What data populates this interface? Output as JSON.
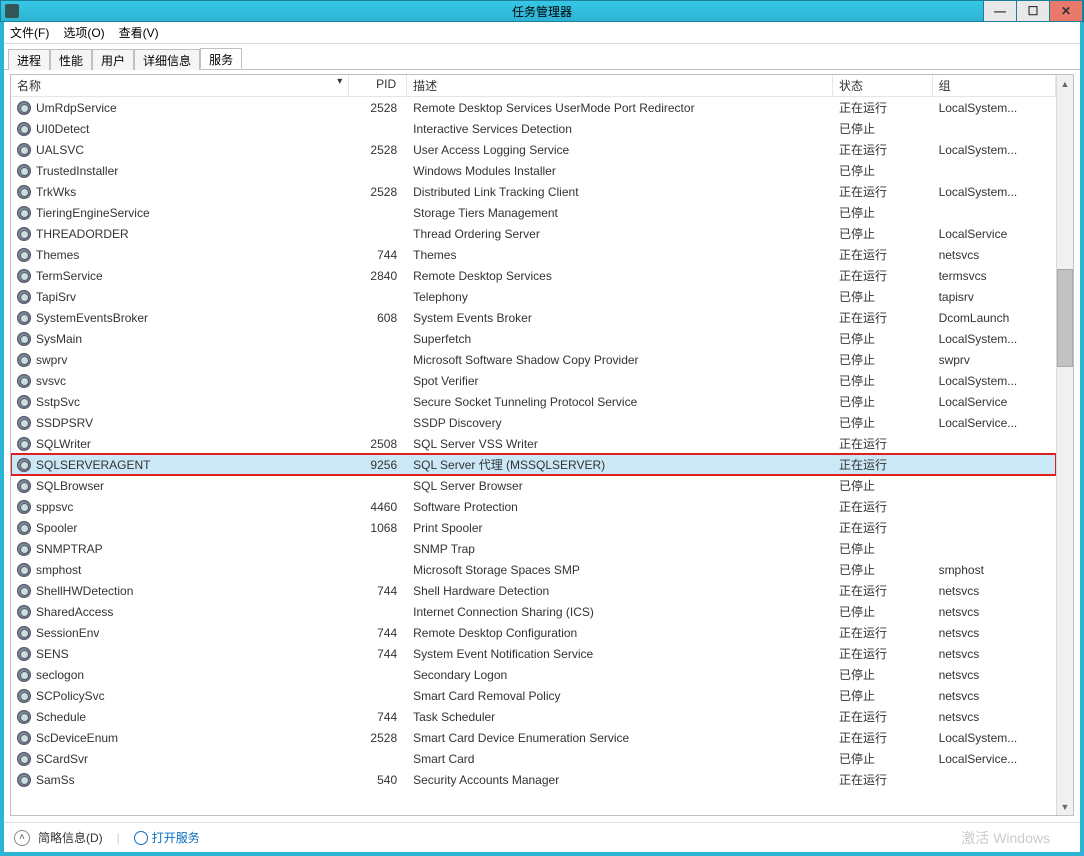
{
  "window": {
    "title": "任务管理器",
    "ctrls": {
      "min": "—",
      "max": "☐",
      "close": "✕"
    }
  },
  "menubar": {
    "file": "文件(F)",
    "options": "选项(O)",
    "view": "查看(V)"
  },
  "tabs": {
    "t0": "进程",
    "t1": "性能",
    "t2": "用户",
    "t3": "详细信息",
    "t4": "服务"
  },
  "columns": {
    "name": "名称",
    "sort_glyph": "▾",
    "pid": "PID",
    "desc": "描述",
    "status": "状态",
    "group": "组"
  },
  "status_labels": {
    "running": "正在运行",
    "stopped": "已停止"
  },
  "services": [
    {
      "name": "UmRdpService",
      "pid": "2528",
      "desc": "Remote Desktop Services UserMode Port Redirector",
      "status": "正在运行",
      "group": "LocalSystem..."
    },
    {
      "name": "UI0Detect",
      "pid": "",
      "desc": "Interactive Services Detection",
      "status": "已停止",
      "group": ""
    },
    {
      "name": "UALSVC",
      "pid": "2528",
      "desc": "User Access Logging Service",
      "status": "正在运行",
      "group": "LocalSystem..."
    },
    {
      "name": "TrustedInstaller",
      "pid": "",
      "desc": "Windows Modules Installer",
      "status": "已停止",
      "group": ""
    },
    {
      "name": "TrkWks",
      "pid": "2528",
      "desc": "Distributed Link Tracking Client",
      "status": "正在运行",
      "group": "LocalSystem..."
    },
    {
      "name": "TieringEngineService",
      "pid": "",
      "desc": "Storage Tiers Management",
      "status": "已停止",
      "group": ""
    },
    {
      "name": "THREADORDER",
      "pid": "",
      "desc": "Thread Ordering Server",
      "status": "已停止",
      "group": "LocalService"
    },
    {
      "name": "Themes",
      "pid": "744",
      "desc": "Themes",
      "status": "正在运行",
      "group": "netsvcs"
    },
    {
      "name": "TermService",
      "pid": "2840",
      "desc": "Remote Desktop Services",
      "status": "正在运行",
      "group": "termsvcs"
    },
    {
      "name": "TapiSrv",
      "pid": "",
      "desc": "Telephony",
      "status": "已停止",
      "group": "tapisrv"
    },
    {
      "name": "SystemEventsBroker",
      "pid": "608",
      "desc": "System Events Broker",
      "status": "正在运行",
      "group": "DcomLaunch"
    },
    {
      "name": "SysMain",
      "pid": "",
      "desc": "Superfetch",
      "status": "已停止",
      "group": "LocalSystem..."
    },
    {
      "name": "swprv",
      "pid": "",
      "desc": "Microsoft Software Shadow Copy Provider",
      "status": "已停止",
      "group": "swprv"
    },
    {
      "name": "svsvc",
      "pid": "",
      "desc": "Spot Verifier",
      "status": "已停止",
      "group": "LocalSystem..."
    },
    {
      "name": "SstpSvc",
      "pid": "",
      "desc": "Secure Socket Tunneling Protocol Service",
      "status": "已停止",
      "group": "LocalService"
    },
    {
      "name": "SSDPSRV",
      "pid": "",
      "desc": "SSDP Discovery",
      "status": "已停止",
      "group": "LocalService..."
    },
    {
      "name": "SQLWriter",
      "pid": "2508",
      "desc": "SQL Server VSS Writer",
      "status": "正在运行",
      "group": ""
    },
    {
      "name": "SQLSERVERAGENT",
      "pid": "9256",
      "desc": "SQL Server 代理 (MSSQLSERVER)",
      "status": "正在运行",
      "group": "",
      "selected": true,
      "highlight": true
    },
    {
      "name": "SQLBrowser",
      "pid": "",
      "desc": "SQL Server Browser",
      "status": "已停止",
      "group": ""
    },
    {
      "name": "sppsvc",
      "pid": "4460",
      "desc": "Software Protection",
      "status": "正在运行",
      "group": ""
    },
    {
      "name": "Spooler",
      "pid": "1068",
      "desc": "Print Spooler",
      "status": "正在运行",
      "group": ""
    },
    {
      "name": "SNMPTRAP",
      "pid": "",
      "desc": "SNMP Trap",
      "status": "已停止",
      "group": ""
    },
    {
      "name": "smphost",
      "pid": "",
      "desc": "Microsoft Storage Spaces SMP",
      "status": "已停止",
      "group": "smphost"
    },
    {
      "name": "ShellHWDetection",
      "pid": "744",
      "desc": "Shell Hardware Detection",
      "status": "正在运行",
      "group": "netsvcs"
    },
    {
      "name": "SharedAccess",
      "pid": "",
      "desc": "Internet Connection Sharing (ICS)",
      "status": "已停止",
      "group": "netsvcs"
    },
    {
      "name": "SessionEnv",
      "pid": "744",
      "desc": "Remote Desktop Configuration",
      "status": "正在运行",
      "group": "netsvcs"
    },
    {
      "name": "SENS",
      "pid": "744",
      "desc": "System Event Notification Service",
      "status": "正在运行",
      "group": "netsvcs"
    },
    {
      "name": "seclogon",
      "pid": "",
      "desc": "Secondary Logon",
      "status": "已停止",
      "group": "netsvcs"
    },
    {
      "name": "SCPolicySvc",
      "pid": "",
      "desc": "Smart Card Removal Policy",
      "status": "已停止",
      "group": "netsvcs"
    },
    {
      "name": "Schedule",
      "pid": "744",
      "desc": "Task Scheduler",
      "status": "正在运行",
      "group": "netsvcs"
    },
    {
      "name": "ScDeviceEnum",
      "pid": "2528",
      "desc": "Smart Card Device Enumeration Service",
      "status": "正在运行",
      "group": "LocalSystem..."
    },
    {
      "name": "SCardSvr",
      "pid": "",
      "desc": "Smart Card",
      "status": "已停止",
      "group": "LocalService..."
    },
    {
      "name": "SamSs",
      "pid": "540",
      "desc": "Security Accounts Manager",
      "status": "正在运行",
      "group": ""
    }
  ],
  "footer": {
    "brief_info": "简略信息(D)",
    "open_services": "打开服务"
  },
  "watermark": "激活 Windows"
}
